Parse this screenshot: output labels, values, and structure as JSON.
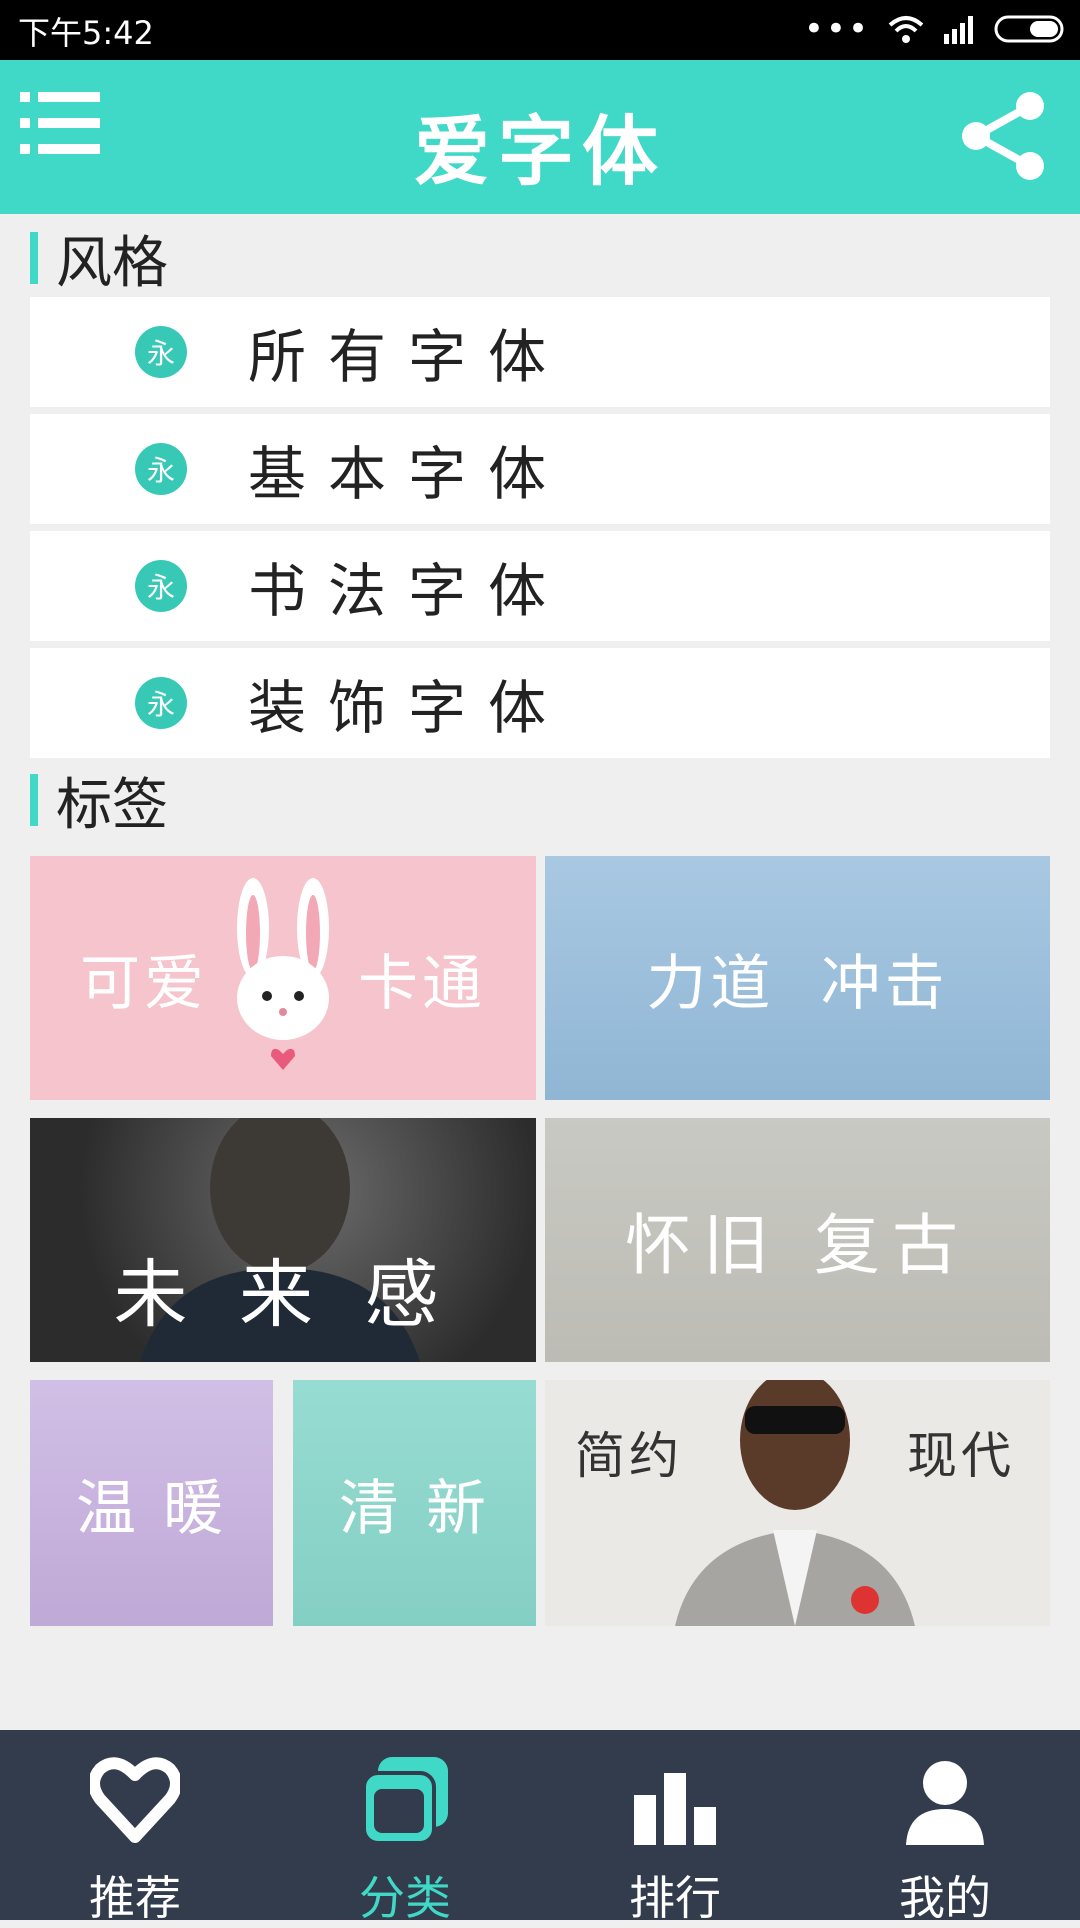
{
  "status_bar": {
    "time": "下午5:42",
    "dots": "•••"
  },
  "app_bar": {
    "title": "爱字体",
    "icons": [
      "menu-icon",
      "share-icon"
    ]
  },
  "style_section": {
    "heading": "风格",
    "badge": "永",
    "items": [
      {
        "label": "所有字体"
      },
      {
        "label": "基本字体"
      },
      {
        "label": "书法字体"
      },
      {
        "label": "装饰字体"
      }
    ]
  },
  "tag_section": {
    "heading": "标签",
    "tiles": [
      {
        "label_left": "可爱",
        "label_right": "卡通",
        "color": "#f5c4cc"
      },
      {
        "label": "力道  冲击",
        "color": "#9cc0dc"
      },
      {
        "label": "未 来 感",
        "color": "#4a4a4a"
      },
      {
        "label": "怀旧 复古",
        "color": "#c6c6c0"
      },
      {
        "label": "温 暖",
        "color": "#c8b6de"
      },
      {
        "label": "清 新",
        "color": "#8dd5cb"
      },
      {
        "label_left": "简约",
        "label_right": "现代",
        "color": "#e9e7e4"
      }
    ]
  },
  "bottom_nav": {
    "tabs": [
      {
        "label": "推荐",
        "icon": "heart-icon",
        "active": false
      },
      {
        "label": "分类",
        "icon": "category-icon",
        "active": true
      },
      {
        "label": "排行",
        "icon": "ranking-icon",
        "active": false
      },
      {
        "label": "我的",
        "icon": "profile-icon",
        "active": false
      }
    ],
    "accent": "#40d8c6"
  }
}
